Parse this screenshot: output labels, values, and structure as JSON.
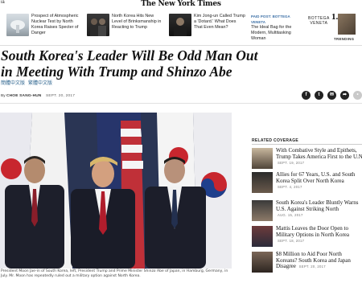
{
  "masthead": {
    "left_fragment": "ia",
    "logo": "The New York Times"
  },
  "strip": {
    "stories": [
      {
        "text": "Prospect of Atmospheric Nuclear Test by North Korea Raises Specter of Danger"
      },
      {
        "text": "North Korea Hits New Level of Brinksmanship in Reacting to Trump"
      },
      {
        "text": "Kim Jong-un Called Trump a 'Dotard.' What Does That Even Mean?"
      }
    ],
    "paid": {
      "label": "PAID POST: BOTTEGA VENETA",
      "text": "The Ideal Bag for the Modern, Multitasking Woman",
      "brand_line1": "BOTTEGA",
      "brand_line2": "VENETA"
    },
    "trending": {
      "number": "1.",
      "label": "TRENDING"
    }
  },
  "article": {
    "headline_line1": "South Korea's Leader Will Be Odd Man Out",
    "headline_line2": "in Meeting With Trump and Shinzo Abe",
    "languages": [
      "簡體中文版",
      "繁體中文版"
    ],
    "byline_prefix": "By",
    "author": "CHOE SANG-HUN",
    "date": "SEPT. 20, 2017",
    "share_icons": [
      "f",
      "t",
      "✉",
      "➦",
      "•"
    ],
    "caption": "President Moon Jae-in of South Korea, left, President Trump and Prime Minister Shinzo Abe of Japan, in Hamburg, Germany, in July. Mr. Moon has repeatedly ruled out a military option against North Korea."
  },
  "related": {
    "header": "RELATED COVERAGE",
    "items": [
      {
        "title": "With Combative Style and Epithets, Trump Takes America First to the U.N.",
        "date": "SEPT. 19, 2017"
      },
      {
        "title": "Allies for 67 Years, U.S. and South Korea Split Over North Korea",
        "date": "SEPT. 4, 2017"
      },
      {
        "title": "South Korea's Leader Bluntly Warns U.S. Against Striking North",
        "date": "AUG. 15, 2017"
      },
      {
        "title": "Mattis Leaves the Door Open to Military Options in North Korea",
        "date": "SEPT. 18, 2017"
      },
      {
        "title": "$8 Million to Aid Poor North Koreans? South Korea and Japan Disagree",
        "date": "SEPT. 20, 2017"
      }
    ]
  }
}
